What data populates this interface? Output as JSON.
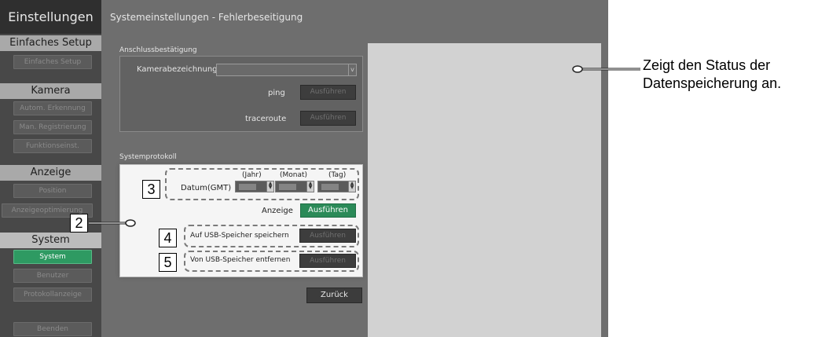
{
  "sidebar": {
    "title": "Einstellungen",
    "sections": [
      {
        "header": "Einfaches Setup",
        "items": [
          "Einfaches Setup"
        ]
      },
      {
        "header": "Kamera",
        "items": [
          "Autom. Erkennung",
          "Man. Registrierung",
          "Funktionseinst."
        ]
      },
      {
        "header": "Anzeige",
        "items": [
          "Position",
          "Anzeigeoptimierung"
        ]
      },
      {
        "header": "System",
        "items": [
          "System",
          "Benutzer",
          "Protokollanzeige"
        ]
      }
    ],
    "quit_label": "Beenden"
  },
  "main": {
    "title": "Systemeinstellungen - Fehlerbeseitigung",
    "connection": {
      "section_label": "Anschlussbestätigung",
      "camera_label": "Kamerabezeichnung",
      "camera_value": "",
      "ping_label": "ping",
      "traceroute_label": "traceroute",
      "run_label": "Ausführen"
    },
    "syslog": {
      "section_label": "Systemprotokoll",
      "date_label": "Datum(GMT)",
      "year_label": "(Jahr)",
      "month_label": "(Monat)",
      "day_label": "(Tag)",
      "display_label": "Anzeige",
      "display_button": "Ausführen",
      "save_usb_label": "Auf USB-Speicher speichern",
      "remove_usb_label": "Von USB-Speicher entfernen",
      "run_label": "Ausführen"
    },
    "back_button": "Zurück"
  },
  "callouts": {
    "n2": "2",
    "n3": "3",
    "n4": "4",
    "n5": "5"
  },
  "annotation": {
    "line1": "Zeigt den Status der",
    "line2": "Datenspeicherung an."
  },
  "colors": {
    "accent_green": "#2b8a58",
    "sidebar_bg": "#484848",
    "panel_bg": "#6e6e6e"
  }
}
